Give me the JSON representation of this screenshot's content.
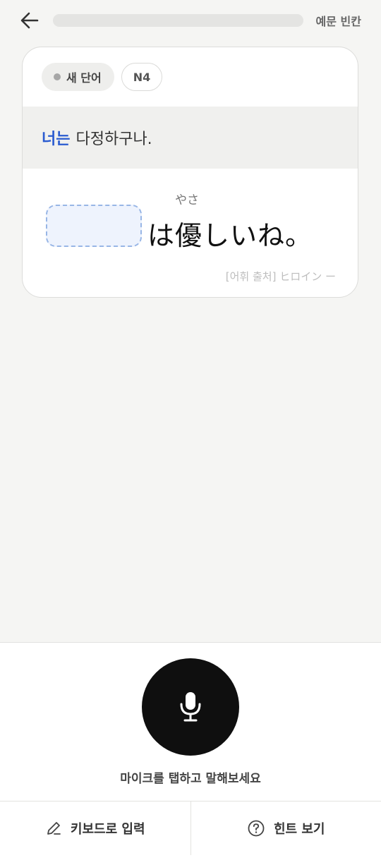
{
  "header": {
    "back_icon": "arrow-left-icon",
    "progress": 0.0,
    "mode_label": "예문 빈칸"
  },
  "card": {
    "badge_new": "새 단어",
    "badge_level": "N4",
    "translation": {
      "highlight": "너는",
      "rest": "다정하구나."
    },
    "sentence": {
      "rest": "は優しいね。",
      "furigana": "やさ"
    },
    "source": "[어휘 출처] ヒロイン ー"
  },
  "bottom": {
    "mic_icon": "microphone-icon",
    "mic_instruction": "마이크를 탭하고 말해보세요",
    "keyboard_label": "키보드로 입력",
    "keyboard_icon": "pencil-icon",
    "hint_label": "힌트 보기",
    "hint_icon": "question-circle-icon"
  },
  "colors": {
    "accent": "#2a5bd0",
    "mic_bg": "#0f0f0f",
    "blank_border": "#98b6e6",
    "blank_fill": "#eef3fd"
  }
}
